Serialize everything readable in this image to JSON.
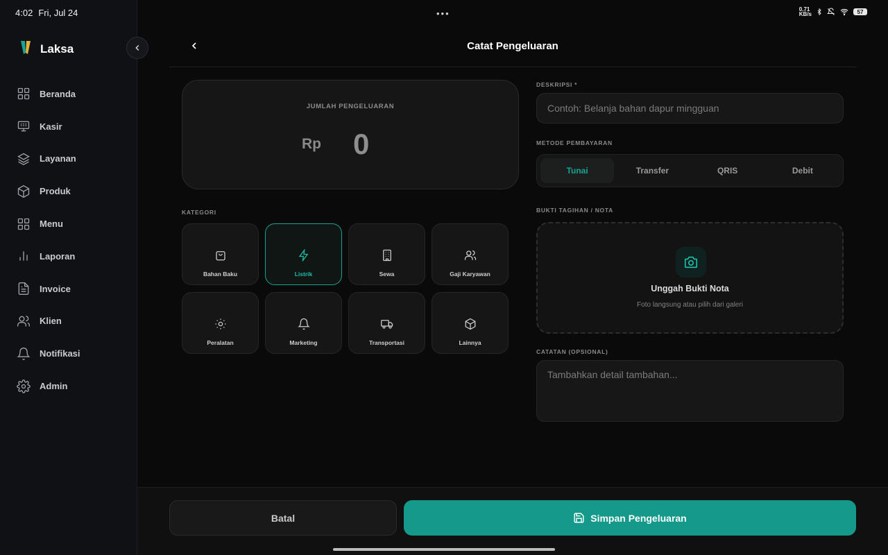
{
  "status_bar": {
    "time": "4:02",
    "date": "Fri, Jul 24",
    "network_speed": "0.71\nKB/s",
    "battery": "57"
  },
  "sidebar": {
    "app_name": "Laksa",
    "items": [
      {
        "label": "Beranda",
        "icon": "grid-icon"
      },
      {
        "label": "Kasir",
        "icon": "cashier-icon"
      },
      {
        "label": "Layanan",
        "icon": "layers-icon"
      },
      {
        "label": "Produk",
        "icon": "box-icon"
      },
      {
        "label": "Menu",
        "icon": "grid-icon"
      },
      {
        "label": "Laporan",
        "icon": "bar-chart-icon"
      },
      {
        "label": "Invoice",
        "icon": "document-icon"
      },
      {
        "label": "Klien",
        "icon": "users-icon"
      },
      {
        "label": "Notifikasi",
        "icon": "bell-icon"
      },
      {
        "label": "Admin",
        "icon": "gear-icon"
      }
    ]
  },
  "header": {
    "title": "Catat Pengeluaran"
  },
  "amount": {
    "label": "JUMLAH PENGELUARAN",
    "currency": "Rp",
    "value": "0"
  },
  "category": {
    "label": "KATEGORI",
    "selected": "Listrik",
    "items": [
      {
        "label": "Bahan Baku",
        "icon": "shopping-bag-icon"
      },
      {
        "label": "Listrik",
        "icon": "lightning-icon"
      },
      {
        "label": "Sewa",
        "icon": "building-icon"
      },
      {
        "label": "Gaji Karyawan",
        "icon": "users-icon"
      },
      {
        "label": "Peralatan",
        "icon": "sun-icon"
      },
      {
        "label": "Marketing",
        "icon": "bell-icon"
      },
      {
        "label": "Transportasi",
        "icon": "truck-icon"
      },
      {
        "label": "Lainnya",
        "icon": "box-icon"
      }
    ]
  },
  "description": {
    "label": "DESKRIPSI *",
    "placeholder": "Contoh: Belanja bahan dapur mingguan",
    "value": ""
  },
  "payment": {
    "label": "METODE PEMBAYARAN",
    "selected": "Tunai",
    "options": [
      "Tunai",
      "Transfer",
      "QRIS",
      "Debit"
    ]
  },
  "receipt": {
    "label": "BUKTI TAGIHAN / NOTA",
    "title": "Unggah Bukti Nota",
    "subtitle": "Foto langsung atau pilih dari galeri"
  },
  "notes": {
    "label": "CATATAN (OPSIONAL)",
    "placeholder": "Tambahkan detail tambahan...",
    "value": ""
  },
  "actions": {
    "cancel": "Batal",
    "save": "Simpan Pengeluaran"
  },
  "colors": {
    "accent": "#14998a",
    "accent_text": "#1fbfa8",
    "background": "#0a0a0a",
    "sidebar": "#0f1115"
  }
}
